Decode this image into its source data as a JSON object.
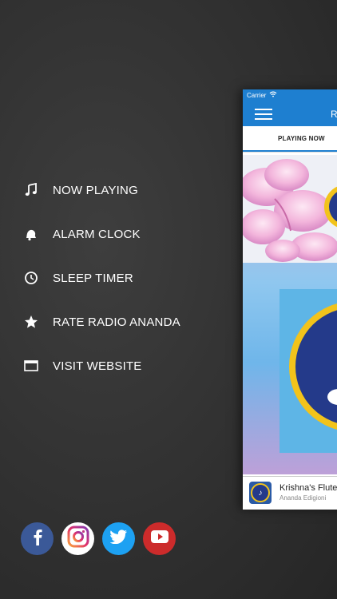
{
  "menu": {
    "items": [
      {
        "label": "NOW PLAYING",
        "icon": "music-note-icon"
      },
      {
        "label": "ALARM CLOCK",
        "icon": "bell-icon"
      },
      {
        "label": "SLEEP TIMER",
        "icon": "clock-icon"
      },
      {
        "label": "RATE RADIO ANANDA",
        "icon": "star-icon"
      },
      {
        "label": "VISIT WEBSITE",
        "icon": "browser-window-icon"
      }
    ]
  },
  "social": [
    {
      "name": "facebook",
      "icon": "facebook-icon",
      "color": "#3b5998"
    },
    {
      "name": "instagram",
      "icon": "instagram-icon",
      "color": "#ffffff"
    },
    {
      "name": "twitter",
      "icon": "twitter-icon",
      "color": "#1da1f2"
    },
    {
      "name": "youtube",
      "icon": "youtube-icon",
      "color": "#cc2b2b"
    }
  ],
  "phone": {
    "carrier": "Carrier",
    "nav_title_partial": "R",
    "tab_label": "PLAYING NOW",
    "accent": "#1e7fd0",
    "player": {
      "title": "Krishna's Flute",
      "artist": "Ananda Edigioni"
    }
  }
}
